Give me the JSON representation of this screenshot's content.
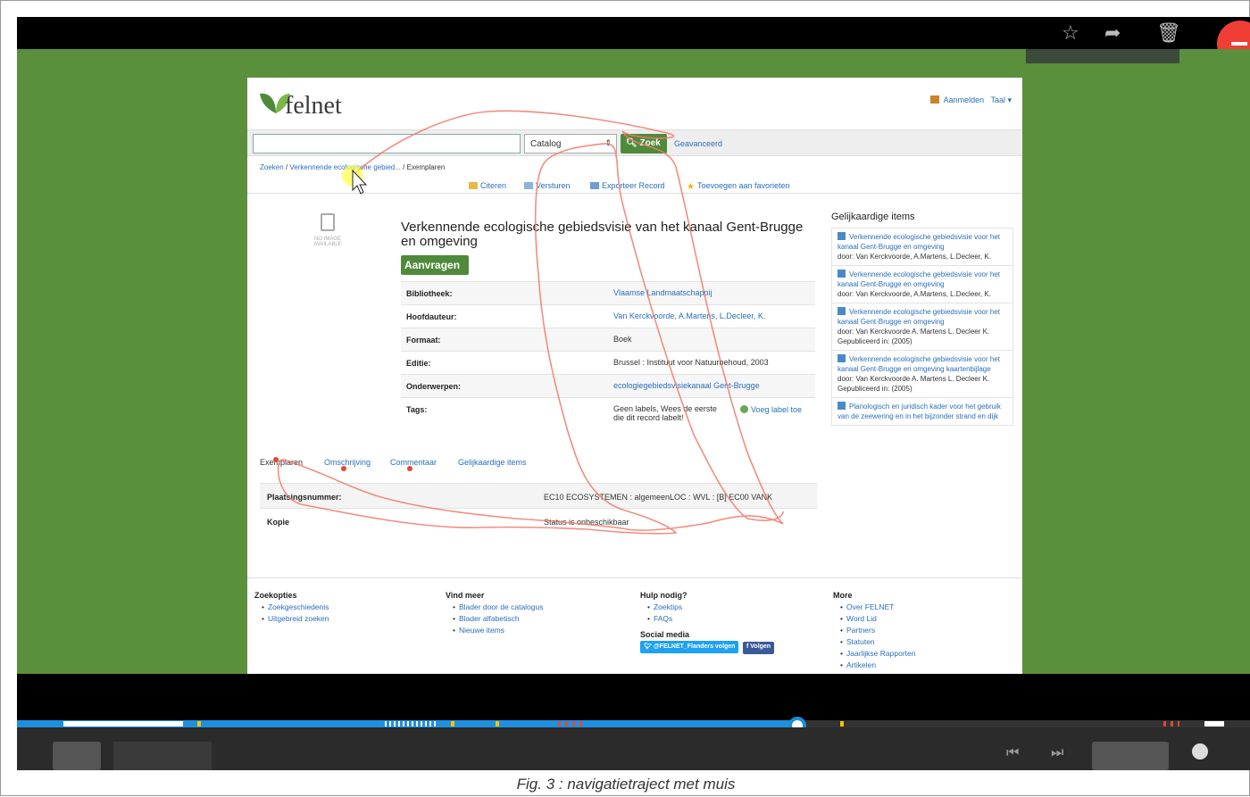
{
  "topbar": {
    "star_icon": "star-icon",
    "share_icon": "share-icon",
    "trash_icon": "trash-icon"
  },
  "header": {
    "logo_text": "felnet",
    "login_label": "Aanmelden",
    "language_label": "Taal ▾"
  },
  "search": {
    "placeholder": "",
    "catalog_value": "Catalog",
    "button_label": "Zoek",
    "advanced_label": "Geavanceerd"
  },
  "breadcrumb": {
    "zoeken": "Zoeken",
    "sep1": " / ",
    "record": "Verkennende ecologische gebied...",
    "sep2": " / ",
    "current": "Exemplaren"
  },
  "toolbar": {
    "citeren": "Citeren",
    "versturen": "Versturen",
    "export": "Exporteer Record",
    "favorite": "Toevoegen aan favorieten"
  },
  "record": {
    "no_image_line1": "NO IMAGE",
    "no_image_line2": "AVAILABLE",
    "title": "Verkennende ecologische gebiedsvisie van het kanaal Gent-Brugge en omgeving",
    "request_button": "Aanvragen",
    "details": [
      {
        "label": "Bibliotheek:",
        "value": "Vlaamse Landmaatschappij",
        "link": true
      },
      {
        "label": "Hoofdauteur:",
        "value": "Van Kerckvoorde, A.Martens, L.Decleer, K.",
        "link": true
      },
      {
        "label": "Formaat:",
        "value": "Boek",
        "link": false
      },
      {
        "label": "Editie:",
        "value": "Brussel : Instituut voor Natuurbehoud, 2003",
        "link": false
      },
      {
        "label": "Onderwerpen:",
        "value": "ecologiegebiedsvisiekanaal Gent-Brugge",
        "link": true
      },
      {
        "label": "Tags:",
        "value": "Geen labels, Wees de eerste die dit record labelt!",
        "link": false
      }
    ],
    "add_tag_label": "Voeg label toe"
  },
  "tabs": [
    {
      "label": "Exemplaren",
      "active": true
    },
    {
      "label": "Omschrijving",
      "active": false
    },
    {
      "label": "Commentaar",
      "active": false
    },
    {
      "label": "Gelijkaardige items",
      "active": false
    }
  ],
  "copies": [
    {
      "label": "Plaatsingsnummer:",
      "value": "EC10 ECOSYSTEMEN : algemeenLOC : WVL : [B] EC00 VANK"
    },
    {
      "label": "Kopie",
      "value": "Status is onbeschikbaar"
    }
  ],
  "similar": {
    "heading": "Gelijkaardige items",
    "items": [
      {
        "title": "Verkennende ecologische gebiedsvisie voor het kanaal Gent-Brugge en omgeving",
        "by": "door: Van Kerckvoorde, A.Martens, L.Decleer, K.",
        "pub": ""
      },
      {
        "title": "Verkennende ecologische gebiedsvisie voor het kanaal Gent-Brugge en omgeving",
        "by": "door: Van Kerckvoorde, A.Martens, L.Decleer, K.",
        "pub": ""
      },
      {
        "title": "Verkennende ecologische gebiedsvisie voor het kanaal Gent-Brugge en omgeving",
        "by": "door: Van Kerckvoorde A. Martens L. Decleer K.",
        "pub": "Gepubliceerd in: (2005)"
      },
      {
        "title": "Verkennende ecologische gebiedsvisie voor het kanaal Gent-Brugge en omgeving kaartenbijlage",
        "by": "door: Van Kerckvoorde A. Martens L. Decleer K.",
        "pub": "Gepubliceerd in: (2005)"
      },
      {
        "title": "Planologisch en juridisch kader voor het gebruik van de zeewering en in het bijzonder strand en dijk",
        "by": "",
        "pub": ""
      }
    ]
  },
  "footer": {
    "col1": {
      "head": "Zoekopties",
      "items": [
        "Zoekgeschiedenis",
        "Uitgebreid zoeken"
      ]
    },
    "col2": {
      "head": "Vind meer",
      "items": [
        "Blader door de catalogus",
        "Blader alfabetisch",
        "Nieuwe items"
      ]
    },
    "col3": {
      "head": "Hulp nodig?",
      "items": [
        "Zoektips",
        "FAQs"
      ],
      "social_head": "Social media",
      "twitter": "@FELNET_Flanders volgen",
      "facebook": "Volgen"
    },
    "col4": {
      "head": "More",
      "items": [
        "Over FELNET",
        "Word Lid",
        "Partners",
        "Statuten",
        "Jaarlijkse Rapporten",
        "Artikelen"
      ]
    }
  },
  "caption": "Fig. 3 : navigatietraject met muis",
  "colors": {
    "page_bg": "#5a8f3c",
    "brand_green": "#4f8a3b",
    "link": "#2a6ebb",
    "trace": "#ef7a6a",
    "timeline": "#1a8fd6"
  }
}
